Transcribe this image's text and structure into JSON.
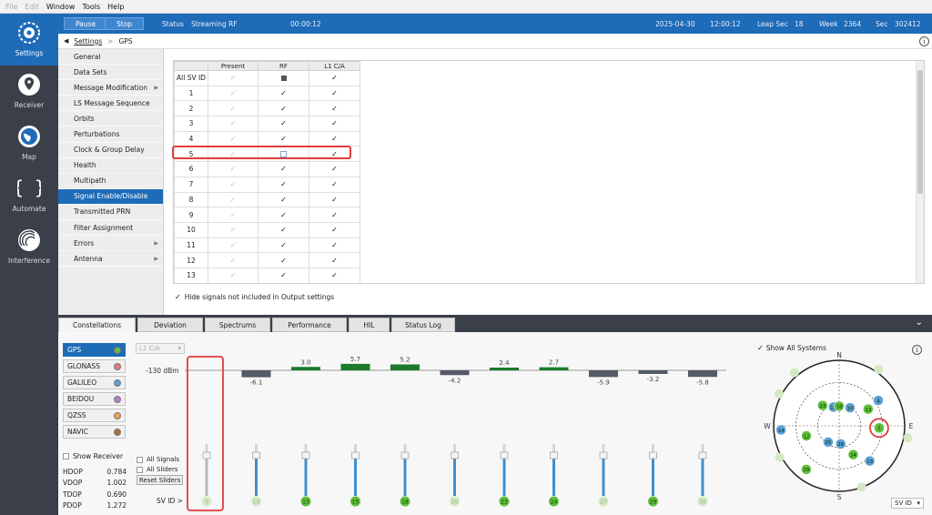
{
  "menu": {
    "items": [
      {
        "label": "File",
        "disabled": true
      },
      {
        "label": "Edit",
        "disabled": true
      },
      {
        "label": "Window",
        "disabled": false
      },
      {
        "label": "Tools",
        "disabled": false
      },
      {
        "label": "Help",
        "disabled": false
      }
    ]
  },
  "nav": {
    "items": [
      {
        "label": "Settings",
        "icon": "gear-icon",
        "active": true
      },
      {
        "label": "Receiver",
        "icon": "location-pin-icon",
        "active": false
      },
      {
        "label": "Map",
        "icon": "globe-icon",
        "active": false
      },
      {
        "label": "Automate",
        "icon": "braces-icon",
        "active": false
      },
      {
        "label": "Interference",
        "icon": "radar-icon",
        "active": false
      }
    ]
  },
  "status": {
    "pause_label": "Pause",
    "stop_label": "Stop",
    "status_label": "Status",
    "status_value": "Streaming RF",
    "elapsed": "00:00:12",
    "date": "2025-04-30",
    "time": "12:00:12",
    "leap_label": "Leap Sec",
    "leap_value": "18",
    "week_label": "Week",
    "week_value": "2364",
    "sec_label": "Sec",
    "sec_value": "302412"
  },
  "breadcrumb": {
    "root": "Settings",
    "separator": ">",
    "current": "GPS"
  },
  "sidemenu": {
    "items": [
      {
        "label": "General",
        "arrow": false,
        "active": false
      },
      {
        "label": "Data Sets",
        "arrow": false,
        "active": false
      },
      {
        "label": "Message Modification",
        "arrow": true,
        "active": false
      },
      {
        "label": "LS Message Sequence",
        "arrow": false,
        "active": false
      },
      {
        "label": "Orbits",
        "arrow": false,
        "active": false
      },
      {
        "label": "Perturbations",
        "arrow": false,
        "active": false
      },
      {
        "label": "Clock & Group Delay",
        "arrow": false,
        "active": false
      },
      {
        "label": "Health",
        "arrow": false,
        "active": false
      },
      {
        "label": "Multipath",
        "arrow": false,
        "active": false
      },
      {
        "label": "Signal Enable/Disable",
        "arrow": false,
        "active": true
      },
      {
        "label": "Transmitted PRN",
        "arrow": false,
        "active": false
      },
      {
        "label": "Filter Assignment",
        "arrow": false,
        "active": false
      },
      {
        "label": "Errors",
        "arrow": true,
        "active": false
      },
      {
        "label": "Antenna",
        "arrow": true,
        "active": false
      }
    ]
  },
  "svtable": {
    "headers": [
      "",
      "Present",
      "RF",
      "L1 C/A"
    ],
    "all_label": "All SV ID",
    "rows": [
      {
        "id": "1",
        "rf": true,
        "l1": true
      },
      {
        "id": "2",
        "rf": true,
        "l1": true
      },
      {
        "id": "3",
        "rf": true,
        "l1": true
      },
      {
        "id": "4",
        "rf": true,
        "l1": true
      },
      {
        "id": "5",
        "rf": false,
        "l1": true
      },
      {
        "id": "6",
        "rf": true,
        "l1": true
      },
      {
        "id": "7",
        "rf": true,
        "l1": true
      },
      {
        "id": "8",
        "rf": true,
        "l1": true
      },
      {
        "id": "9",
        "rf": true,
        "l1": true
      },
      {
        "id": "10",
        "rf": true,
        "l1": true
      },
      {
        "id": "11",
        "rf": true,
        "l1": true
      },
      {
        "id": "12",
        "rf": true,
        "l1": true
      },
      {
        "id": "13",
        "rf": true,
        "l1": true
      }
    ]
  },
  "hide_signals_label": "Hide signals not included in Output settings",
  "bottom_tabs": [
    "Constellations",
    "Deviation",
    "Spectrums",
    "Performance",
    "HIL",
    "Status Log"
  ],
  "constellations": [
    {
      "label": "GPS",
      "color": "#5fbf3a",
      "active": true
    },
    {
      "label": "GLONASS",
      "color": "#e07a7a",
      "active": false
    },
    {
      "label": "GALILEO",
      "color": "#5a9fd6",
      "active": false
    },
    {
      "label": "BEIDOU",
      "color": "#b67fd1",
      "active": false
    },
    {
      "label": "QZSS",
      "color": "#e9a259",
      "active": false
    },
    {
      "label": "NAVIC",
      "color": "#a8703b",
      "active": false
    }
  ],
  "show_receiver_label": "Show Receiver",
  "dop": [
    {
      "label": "HDOP",
      "value": "0.784"
    },
    {
      "label": "VDOP",
      "value": "1.002"
    },
    {
      "label": "TDOP",
      "value": "0.690"
    },
    {
      "label": "PDOP",
      "value": "1.272"
    }
  ],
  "signal_select": "L1 C/A",
  "all_signals_label": "All Signals",
  "all_sliders_label": "All Sliders",
  "reset_sliders_label": "Reset Sliders",
  "svid_label": "SV ID >",
  "power": {
    "reference_label": "-130 dBm",
    "svs": [
      {
        "id": "5",
        "offset": null,
        "dim": true
      },
      {
        "id": "10",
        "offset": -6.1,
        "dim": true
      },
      {
        "id": "13",
        "offset": 3.0,
        "dim": false
      },
      {
        "id": "15",
        "offset": 5.7,
        "dim": false
      },
      {
        "id": "18",
        "offset": 5.2,
        "dim": false
      },
      {
        "id": "20",
        "offset": -4.2,
        "dim": true
      },
      {
        "id": "23",
        "offset": 2.4,
        "dim": false
      },
      {
        "id": "24",
        "offset": 2.7,
        "dim": false
      },
      {
        "id": "27",
        "offset": -5.9,
        "dim": true
      },
      {
        "id": "29",
        "offset": -3.2,
        "dim": false
      },
      {
        "id": "30",
        "offset": -5.8,
        "dim": true
      }
    ]
  },
  "skyplot": {
    "show_all_label": "Show All Systems",
    "north": "N",
    "south": "S",
    "east": "E",
    "west": "W",
    "sv_select": "SV ID",
    "sats": [
      {
        "id": "23",
        "type": "gps",
        "az": 321,
        "el": 54
      },
      {
        "id": "15",
        "type": "gal",
        "az": 343,
        "el": 63
      },
      {
        "id": "10",
        "type": "gal",
        "az": 31,
        "el": 61
      },
      {
        "id": "18",
        "type": "gps",
        "az": 0,
        "el": 63
      },
      {
        "id": "13",
        "type": "gps",
        "az": 60,
        "el": 44
      },
      {
        "id": "4",
        "type": "gal",
        "az": 57,
        "el": 26
      },
      {
        "id": "5",
        "type": "gps",
        "az": 93,
        "el": 35
      },
      {
        "id": "14",
        "type": "gal",
        "az": 266,
        "el": 10
      },
      {
        "id": "25",
        "type": "gal",
        "az": 214,
        "el": 63
      },
      {
        "id": "26",
        "type": "gal",
        "az": 175,
        "el": 65
      },
      {
        "id": "24",
        "type": "gps",
        "az": 154,
        "el": 46
      },
      {
        "id": "29",
        "type": "gps",
        "az": 217,
        "el": 15
      },
      {
        "id": "13",
        "type": "gal",
        "az": 139,
        "el": 26
      },
      {
        "id": "12",
        "type": "gps",
        "az": 253,
        "el": 43
      }
    ]
  }
}
